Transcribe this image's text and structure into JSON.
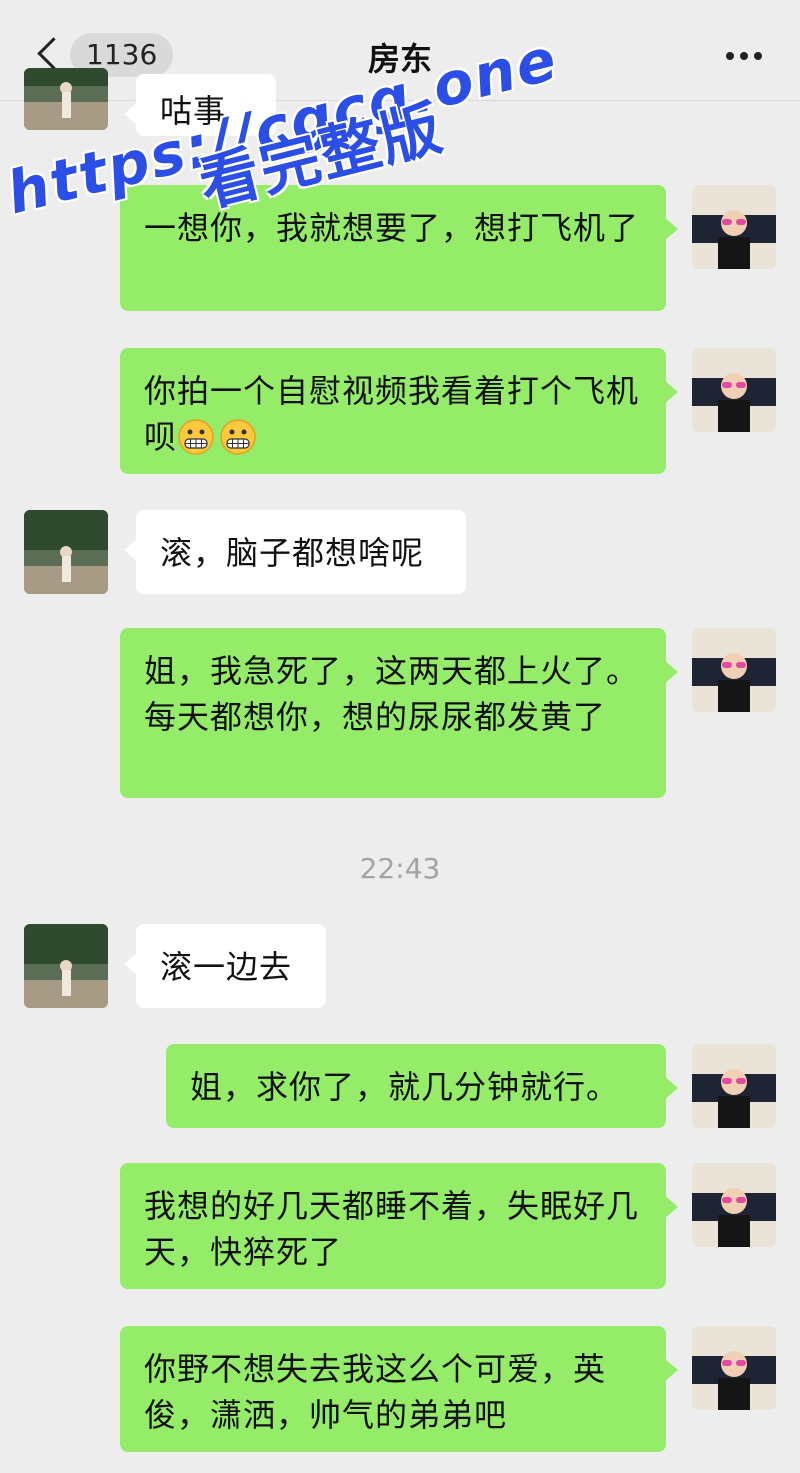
{
  "header": {
    "unread_count": "1136",
    "title": "房东"
  },
  "messages": [
    {
      "text": "咕事"
    },
    {
      "text": "一想你，我就想要了，想打飞机了"
    },
    {
      "text": "你拍一个自慰视频我看着打个飞机呗",
      "emoji": [
        "grimacing-emoji",
        "grimacing-emoji"
      ]
    },
    {
      "text": "滚，脑子都想啥呢"
    },
    {
      "text": "姐，我急死了，这两天都上火了。每天都想你，想的尿尿都发黄了"
    },
    {
      "text": "滚一边去"
    },
    {
      "text": "姐，求你了，就几分钟就行。"
    },
    {
      "text": "我想的好几天都睡不着，失眠好几天，快猝死了"
    },
    {
      "text": "你野不想失去我这么个可爱，英俊，潇洒，帅气的弟弟吧"
    }
  ],
  "timestamp": "22:43",
  "watermark": {
    "url": "https://cgcg.one",
    "caption": "看完整版"
  },
  "colors": {
    "background": "#ededed",
    "outgoing_bubble": "#95ec69",
    "incoming_bubble": "#ffffff",
    "watermark": "#2a4ee6"
  },
  "icons": [
    "back-chevron-icon",
    "more-dots-icon"
  ]
}
